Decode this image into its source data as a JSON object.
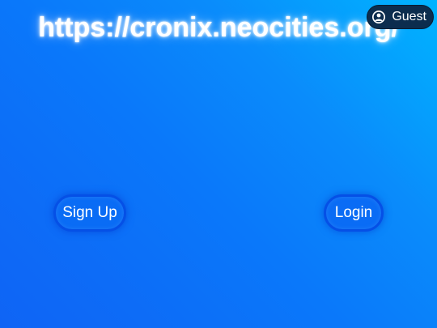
{
  "header": {
    "site_url": "https://cronix.neocities.org/"
  },
  "account": {
    "guest_label": "Guest",
    "icon": "user-avatar-icon"
  },
  "auth": {
    "signup_label": "Sign Up",
    "login_label": "Login"
  },
  "colors": {
    "background_start": "#00b4ff",
    "background_end": "#0f64f5",
    "button_fill": "#0a6cf5",
    "button_border": "#0550e6",
    "guest_badge": "#0c2d4e"
  }
}
